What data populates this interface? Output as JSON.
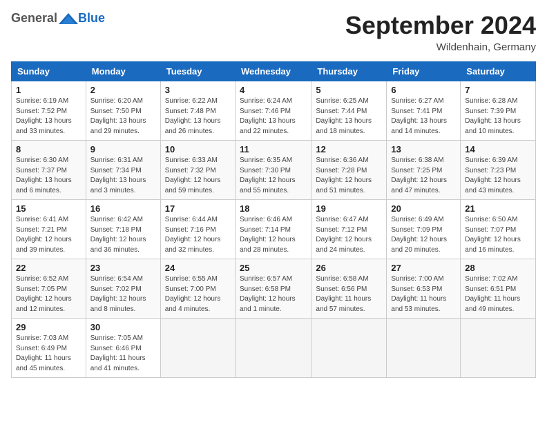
{
  "header": {
    "logo_general": "General",
    "logo_blue": "Blue",
    "month": "September 2024",
    "location": "Wildenhain, Germany"
  },
  "days_of_week": [
    "Sunday",
    "Monday",
    "Tuesday",
    "Wednesday",
    "Thursday",
    "Friday",
    "Saturday"
  ],
  "weeks": [
    [
      {
        "day": 1,
        "detail": "Sunrise: 6:19 AM\nSunset: 7:52 PM\nDaylight: 13 hours\nand 33 minutes."
      },
      {
        "day": 2,
        "detail": "Sunrise: 6:20 AM\nSunset: 7:50 PM\nDaylight: 13 hours\nand 29 minutes."
      },
      {
        "day": 3,
        "detail": "Sunrise: 6:22 AM\nSunset: 7:48 PM\nDaylight: 13 hours\nand 26 minutes."
      },
      {
        "day": 4,
        "detail": "Sunrise: 6:24 AM\nSunset: 7:46 PM\nDaylight: 13 hours\nand 22 minutes."
      },
      {
        "day": 5,
        "detail": "Sunrise: 6:25 AM\nSunset: 7:44 PM\nDaylight: 13 hours\nand 18 minutes."
      },
      {
        "day": 6,
        "detail": "Sunrise: 6:27 AM\nSunset: 7:41 PM\nDaylight: 13 hours\nand 14 minutes."
      },
      {
        "day": 7,
        "detail": "Sunrise: 6:28 AM\nSunset: 7:39 PM\nDaylight: 13 hours\nand 10 minutes."
      }
    ],
    [
      {
        "day": 8,
        "detail": "Sunrise: 6:30 AM\nSunset: 7:37 PM\nDaylight: 13 hours\nand 6 minutes."
      },
      {
        "day": 9,
        "detail": "Sunrise: 6:31 AM\nSunset: 7:34 PM\nDaylight: 13 hours\nand 3 minutes."
      },
      {
        "day": 10,
        "detail": "Sunrise: 6:33 AM\nSunset: 7:32 PM\nDaylight: 12 hours\nand 59 minutes."
      },
      {
        "day": 11,
        "detail": "Sunrise: 6:35 AM\nSunset: 7:30 PM\nDaylight: 12 hours\nand 55 minutes."
      },
      {
        "day": 12,
        "detail": "Sunrise: 6:36 AM\nSunset: 7:28 PM\nDaylight: 12 hours\nand 51 minutes."
      },
      {
        "day": 13,
        "detail": "Sunrise: 6:38 AM\nSunset: 7:25 PM\nDaylight: 12 hours\nand 47 minutes."
      },
      {
        "day": 14,
        "detail": "Sunrise: 6:39 AM\nSunset: 7:23 PM\nDaylight: 12 hours\nand 43 minutes."
      }
    ],
    [
      {
        "day": 15,
        "detail": "Sunrise: 6:41 AM\nSunset: 7:21 PM\nDaylight: 12 hours\nand 39 minutes."
      },
      {
        "day": 16,
        "detail": "Sunrise: 6:42 AM\nSunset: 7:18 PM\nDaylight: 12 hours\nand 36 minutes."
      },
      {
        "day": 17,
        "detail": "Sunrise: 6:44 AM\nSunset: 7:16 PM\nDaylight: 12 hours\nand 32 minutes."
      },
      {
        "day": 18,
        "detail": "Sunrise: 6:46 AM\nSunset: 7:14 PM\nDaylight: 12 hours\nand 28 minutes."
      },
      {
        "day": 19,
        "detail": "Sunrise: 6:47 AM\nSunset: 7:12 PM\nDaylight: 12 hours\nand 24 minutes."
      },
      {
        "day": 20,
        "detail": "Sunrise: 6:49 AM\nSunset: 7:09 PM\nDaylight: 12 hours\nand 20 minutes."
      },
      {
        "day": 21,
        "detail": "Sunrise: 6:50 AM\nSunset: 7:07 PM\nDaylight: 12 hours\nand 16 minutes."
      }
    ],
    [
      {
        "day": 22,
        "detail": "Sunrise: 6:52 AM\nSunset: 7:05 PM\nDaylight: 12 hours\nand 12 minutes."
      },
      {
        "day": 23,
        "detail": "Sunrise: 6:54 AM\nSunset: 7:02 PM\nDaylight: 12 hours\nand 8 minutes."
      },
      {
        "day": 24,
        "detail": "Sunrise: 6:55 AM\nSunset: 7:00 PM\nDaylight: 12 hours\nand 4 minutes."
      },
      {
        "day": 25,
        "detail": "Sunrise: 6:57 AM\nSunset: 6:58 PM\nDaylight: 12 hours\nand 1 minute."
      },
      {
        "day": 26,
        "detail": "Sunrise: 6:58 AM\nSunset: 6:56 PM\nDaylight: 11 hours\nand 57 minutes."
      },
      {
        "day": 27,
        "detail": "Sunrise: 7:00 AM\nSunset: 6:53 PM\nDaylight: 11 hours\nand 53 minutes."
      },
      {
        "day": 28,
        "detail": "Sunrise: 7:02 AM\nSunset: 6:51 PM\nDaylight: 11 hours\nand 49 minutes."
      }
    ],
    [
      {
        "day": 29,
        "detail": "Sunrise: 7:03 AM\nSunset: 6:49 PM\nDaylight: 11 hours\nand 45 minutes."
      },
      {
        "day": 30,
        "detail": "Sunrise: 7:05 AM\nSunset: 6:46 PM\nDaylight: 11 hours\nand 41 minutes."
      },
      null,
      null,
      null,
      null,
      null
    ]
  ]
}
